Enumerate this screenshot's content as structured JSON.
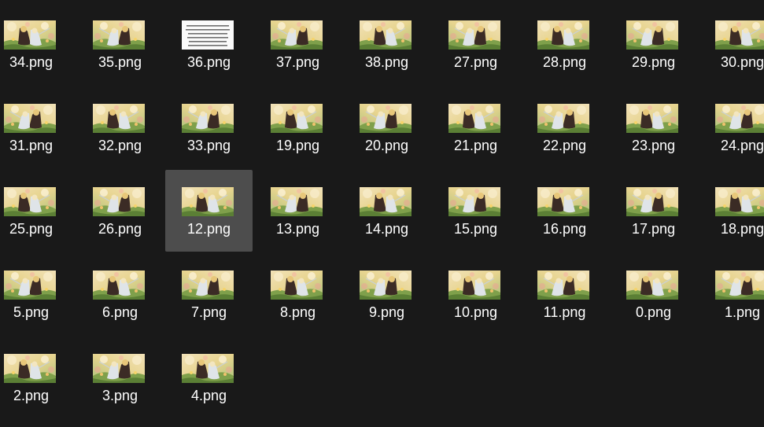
{
  "window": {
    "background": "#191919",
    "selection_color": "#4d4d4d",
    "label_color": "#ffffff"
  },
  "files": [
    {
      "name": "34.png",
      "thumb": "anime-art",
      "selected": false
    },
    {
      "name": "35.png",
      "thumb": "anime-art",
      "selected": false
    },
    {
      "name": "36.png",
      "thumb": "text-document",
      "selected": false
    },
    {
      "name": "37.png",
      "thumb": "anime-art",
      "selected": false
    },
    {
      "name": "38.png",
      "thumb": "anime-art",
      "selected": false
    },
    {
      "name": "27.png",
      "thumb": "anime-art",
      "selected": false
    },
    {
      "name": "28.png",
      "thumb": "anime-art",
      "selected": false
    },
    {
      "name": "29.png",
      "thumb": "anime-art",
      "selected": false
    },
    {
      "name": "30.png",
      "thumb": "anime-art",
      "selected": false
    },
    {
      "name": "31.png",
      "thumb": "anime-art",
      "selected": false
    },
    {
      "name": "32.png",
      "thumb": "anime-art",
      "selected": false
    },
    {
      "name": "33.png",
      "thumb": "anime-art",
      "selected": false
    },
    {
      "name": "19.png",
      "thumb": "anime-art",
      "selected": false
    },
    {
      "name": "20.png",
      "thumb": "anime-art",
      "selected": false
    },
    {
      "name": "21.png",
      "thumb": "anime-art",
      "selected": false
    },
    {
      "name": "22.png",
      "thumb": "anime-art",
      "selected": false
    },
    {
      "name": "23.png",
      "thumb": "anime-art",
      "selected": false
    },
    {
      "name": "24.png",
      "thumb": "anime-art",
      "selected": false
    },
    {
      "name": "25.png",
      "thumb": "anime-art",
      "selected": false
    },
    {
      "name": "26.png",
      "thumb": "anime-art",
      "selected": false
    },
    {
      "name": "12.png",
      "thumb": "anime-art",
      "selected": true
    },
    {
      "name": "13.png",
      "thumb": "anime-art",
      "selected": false
    },
    {
      "name": "14.png",
      "thumb": "anime-art",
      "selected": false
    },
    {
      "name": "15.png",
      "thumb": "anime-art",
      "selected": false
    },
    {
      "name": "16.png",
      "thumb": "anime-art",
      "selected": false
    },
    {
      "name": "17.png",
      "thumb": "anime-art",
      "selected": false
    },
    {
      "name": "18.png",
      "thumb": "anime-art",
      "selected": false
    },
    {
      "name": "5.png",
      "thumb": "anime-art",
      "selected": false
    },
    {
      "name": "6.png",
      "thumb": "anime-art",
      "selected": false
    },
    {
      "name": "7.png",
      "thumb": "anime-art",
      "selected": false
    },
    {
      "name": "8.png",
      "thumb": "anime-art",
      "selected": false
    },
    {
      "name": "9.png",
      "thumb": "anime-art",
      "selected": false
    },
    {
      "name": "10.png",
      "thumb": "anime-art",
      "selected": false
    },
    {
      "name": "11.png",
      "thumb": "anime-art",
      "selected": false
    },
    {
      "name": "0.png",
      "thumb": "anime-art",
      "selected": false
    },
    {
      "name": "1.png",
      "thumb": "anime-art",
      "selected": false
    },
    {
      "name": "2.png",
      "thumb": "anime-art",
      "selected": false
    },
    {
      "name": "3.png",
      "thumb": "anime-art",
      "selected": false
    },
    {
      "name": "4.png",
      "thumb": "anime-art",
      "selected": false
    }
  ]
}
